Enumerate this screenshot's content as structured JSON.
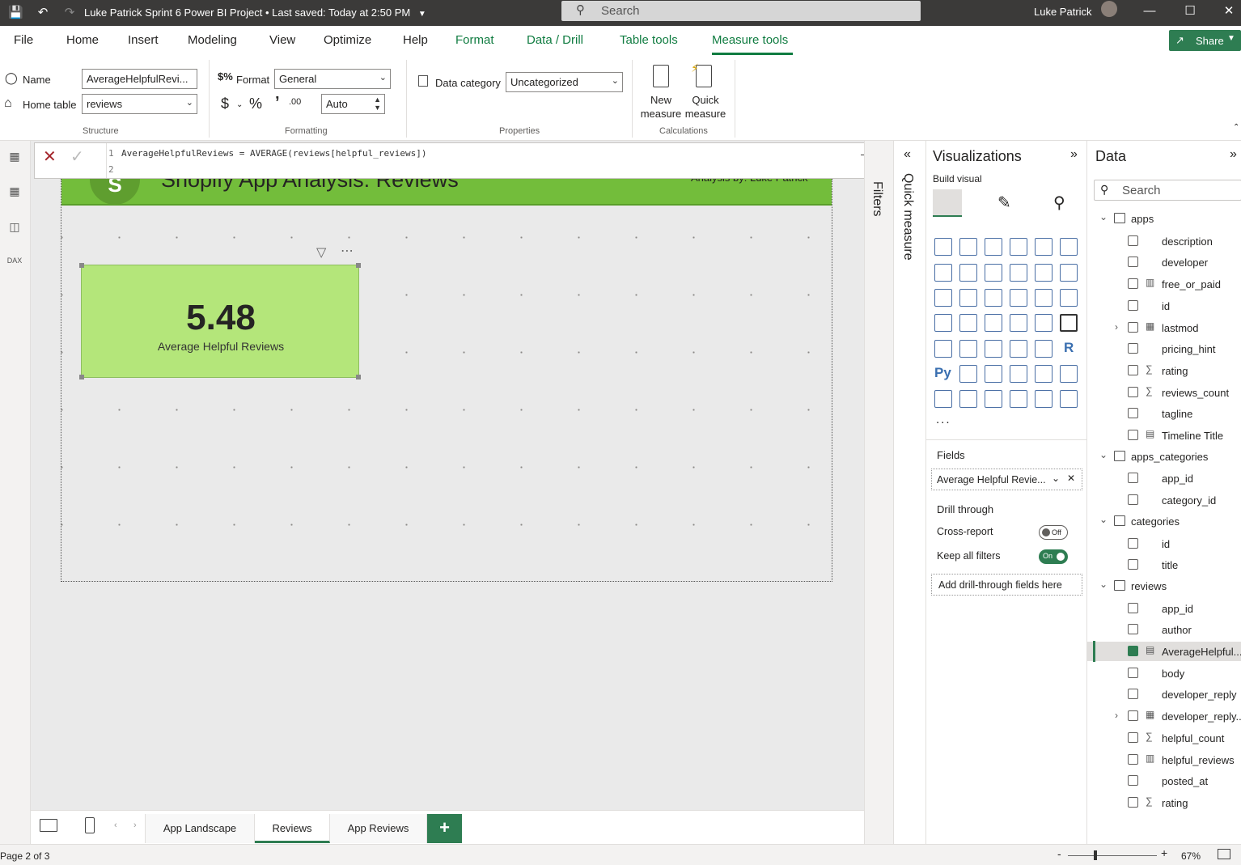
{
  "titlebar": {
    "document_title": "Luke Patrick Sprint 6 Power BI Project",
    "save_status": "Last saved: Today at 2:50 PM",
    "search_placeholder": "Search",
    "user": "Luke Patrick"
  },
  "menu": {
    "tabs": [
      "File",
      "Home",
      "Insert",
      "Modeling",
      "View",
      "Optimize",
      "Help",
      "Format",
      "Data / Drill",
      "Table tools",
      "Measure tools"
    ],
    "share_label": "Share"
  },
  "ribbon": {
    "structure": {
      "name_label": "Name",
      "name_value": "AverageHelpfulRevi...",
      "home_table_label": "Home table",
      "home_table_value": "reviews",
      "caption": "Structure"
    },
    "formatting": {
      "format_label": "Format",
      "format_value": "General",
      "decimals_value": "Auto",
      "caption": "Formatting"
    },
    "properties": {
      "data_category_label": "Data category",
      "data_category_value": "Uncategorized",
      "caption": "Properties"
    },
    "calculations": {
      "new_measure_label": "New measure",
      "quick_measure_label": "Quick measure",
      "caption": "Calculations"
    }
  },
  "formula": {
    "line1_num": "1",
    "line2_num": "2",
    "text": "AverageHelpfulReviews = AVERAGE(reviews[helpful_reviews])"
  },
  "canvas": {
    "header_title": "Shopify App Analysis: Reviews",
    "header_byline": "Analysis by: Luke Patrick",
    "card_value": "5.48",
    "card_label": "Average Helpful Reviews"
  },
  "side_strips": {
    "filters_label": "Filters",
    "quick_measure_label": "Quick measure"
  },
  "visualizations": {
    "title": "Visualizations",
    "build_visual_label": "Build visual",
    "more_label": "...",
    "fields_label": "Fields",
    "field_value": "Average Helpful Revie...",
    "drill_through_label": "Drill through",
    "cross_report_label": "Cross-report",
    "cross_report_state": "Off",
    "keep_filters_label": "Keep all filters",
    "keep_filters_state": "On",
    "add_drill_label": "Add drill-through fields here",
    "py_label": "Py",
    "r_label": "R"
  },
  "data_pane": {
    "title": "Data",
    "search_placeholder": "Search",
    "tables": [
      {
        "name": "apps",
        "fields": [
          {
            "name": "description",
            "icon": ""
          },
          {
            "name": "developer",
            "icon": ""
          },
          {
            "name": "free_or_paid",
            "icon": "calc-column"
          },
          {
            "name": "id",
            "icon": ""
          },
          {
            "name": "lastmod",
            "icon": "calendar",
            "expandable": true
          },
          {
            "name": "pricing_hint",
            "icon": ""
          },
          {
            "name": "rating",
            "icon": "sigma"
          },
          {
            "name": "reviews_count",
            "icon": "sigma"
          },
          {
            "name": "tagline",
            "icon": ""
          },
          {
            "name": "Timeline Title",
            "icon": "measure"
          }
        ]
      },
      {
        "name": "apps_categories",
        "fields": [
          {
            "name": "app_id",
            "icon": ""
          },
          {
            "name": "category_id",
            "icon": ""
          }
        ]
      },
      {
        "name": "categories",
        "fields": [
          {
            "name": "id",
            "icon": ""
          },
          {
            "name": "title",
            "icon": ""
          }
        ]
      },
      {
        "name": "reviews",
        "fields": [
          {
            "name": "app_id",
            "icon": ""
          },
          {
            "name": "author",
            "icon": ""
          },
          {
            "name": "AverageHelpful...",
            "icon": "measure",
            "checked": true
          },
          {
            "name": "body",
            "icon": ""
          },
          {
            "name": "developer_reply",
            "icon": ""
          },
          {
            "name": "developer_reply...",
            "icon": "calendar",
            "expandable": true
          },
          {
            "name": "helpful_count",
            "icon": "sigma"
          },
          {
            "name": "helpful_reviews",
            "icon": "calc-column"
          },
          {
            "name": "posted_at",
            "icon": ""
          },
          {
            "name": "rating",
            "icon": "sigma"
          }
        ]
      }
    ]
  },
  "pages": {
    "tabs": [
      "App Landscape",
      "Reviews",
      "App Reviews"
    ],
    "active": "Reviews",
    "add_label": "+"
  },
  "status": {
    "page_indicator": "Page 2 of 3",
    "zoom": "67%"
  }
}
